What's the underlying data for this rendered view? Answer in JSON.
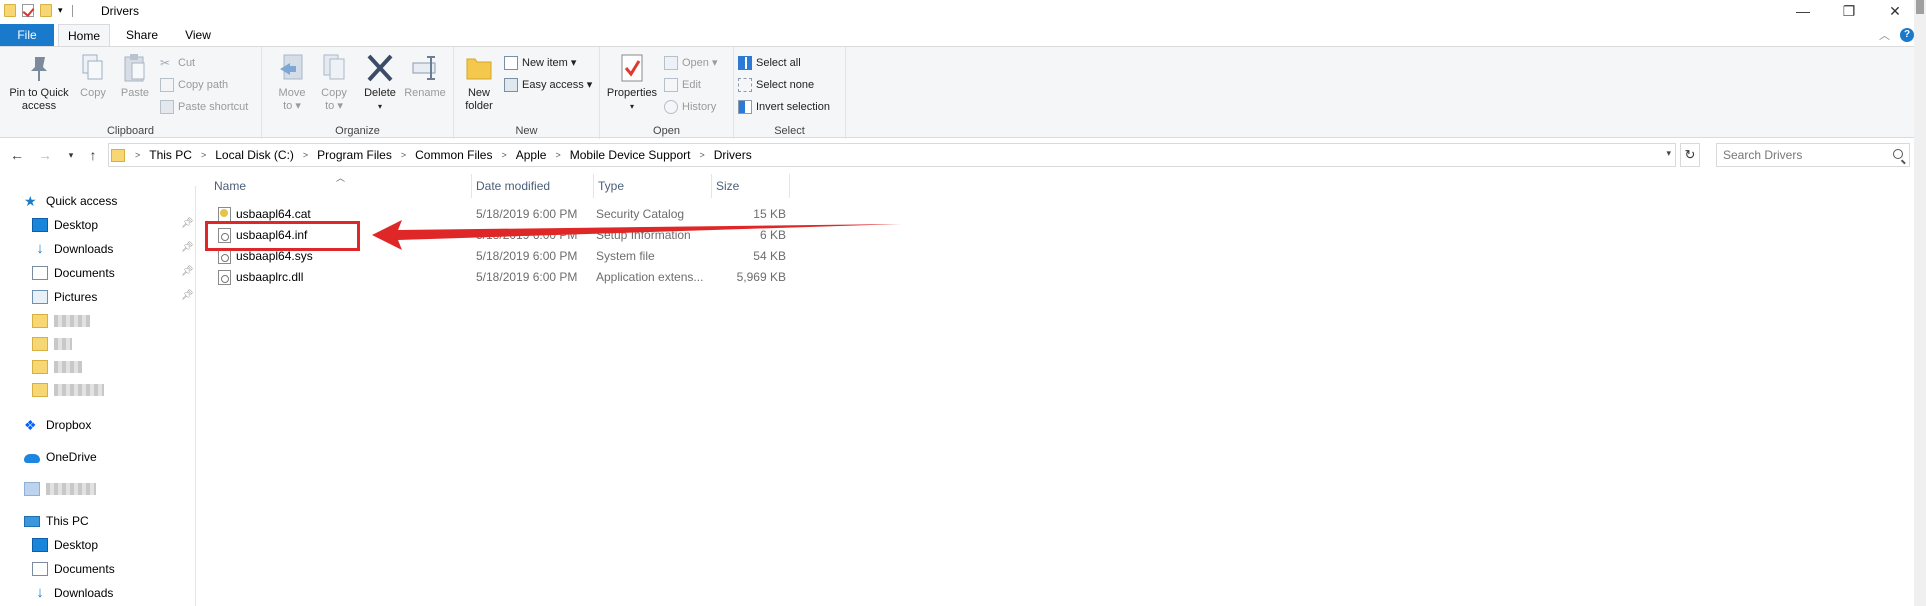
{
  "window": {
    "title": "Drivers",
    "minimize": "—",
    "restore": "❐",
    "close": "✕"
  },
  "ribbon_tabs": [
    "File",
    "Home",
    "Share",
    "View"
  ],
  "ribbon": {
    "clipboard": {
      "label": "Clipboard",
      "pin_to_quick_access": [
        "Pin to Quick",
        "access"
      ],
      "copy": "Copy",
      "paste": "Paste",
      "cut": "Cut",
      "copy_path": "Copy path",
      "paste_shortcut": "Paste shortcut"
    },
    "organize": {
      "label": "Organize",
      "move_to": [
        "Move",
        "to ▾"
      ],
      "copy_to": [
        "Copy",
        "to ▾"
      ],
      "delete": "Delete",
      "rename": "Rename"
    },
    "new": {
      "label": "New",
      "new_folder": [
        "New",
        "folder"
      ],
      "new_item": "New item ▾",
      "easy_access": "Easy access ▾"
    },
    "open": {
      "label": "Open",
      "properties": "Properties",
      "open": "Open ▾",
      "edit": "Edit",
      "history": "History"
    },
    "select": {
      "label": "Select",
      "select_all": "Select all",
      "select_none": "Select none",
      "invert_selection": "Invert selection"
    }
  },
  "address_bar": {
    "breadcrumbs": [
      "This PC",
      "Local Disk (C:)",
      "Program Files",
      "Common Files",
      "Apple",
      "Mobile Device Support",
      "Drivers"
    ],
    "search_placeholder": "Search Drivers"
  },
  "nav_pane": {
    "quick_access": "Quick access",
    "quick_items": [
      "Desktop",
      "Downloads",
      "Documents",
      "Pictures"
    ],
    "dropbox": "Dropbox",
    "onedrive": "OneDrive",
    "this_pc": "This PC",
    "pc_items": [
      "Desktop",
      "Documents",
      "Downloads"
    ]
  },
  "columns": [
    "Name",
    "Date modified",
    "Type",
    "Size"
  ],
  "files": [
    {
      "name": "usbaapl64.cat",
      "date": "5/18/2019 6:00 PM",
      "type": "Security Catalog",
      "size": "15 KB",
      "icon": "catalog-icon"
    },
    {
      "name": "usbaapl64.inf",
      "date": "5/18/2019 6:00 PM",
      "type": "Setup Information",
      "size": "6 KB",
      "icon": "setup-info-icon"
    },
    {
      "name": "usbaapl64.sys",
      "date": "5/18/2019 6:00 PM",
      "type": "System file",
      "size": "54 KB",
      "icon": "system-file-icon"
    },
    {
      "name": "usbaaplrc.dll",
      "date": "5/18/2019 6:00 PM",
      "type": "Application extens...",
      "size": "5,969 KB",
      "icon": "dll-icon"
    }
  ],
  "annotation_color": "#e02727",
  "accent_color": "#1979ca"
}
